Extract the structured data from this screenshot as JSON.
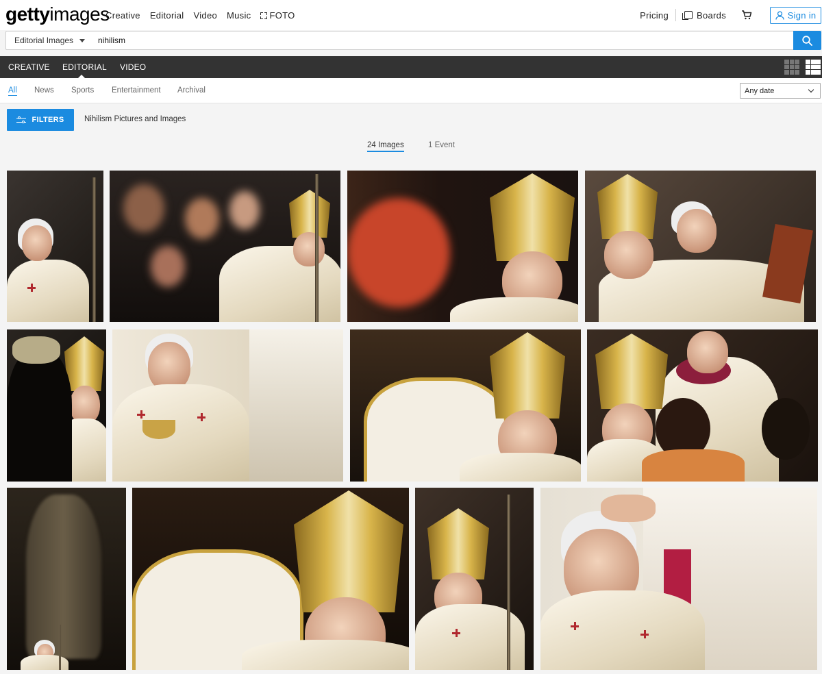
{
  "brand": {
    "logo_bold": "getty",
    "logo_light": "images"
  },
  "topnav": {
    "items": [
      "Creative",
      "Editorial",
      "Video",
      "Music",
      "FOTO"
    ]
  },
  "account": {
    "pricing": "Pricing",
    "boards": "Boards",
    "signin": "Sign in"
  },
  "search": {
    "type_label": "Editorial Images",
    "query": "nihilism"
  },
  "content_types": {
    "tabs": [
      "CREATIVE",
      "EDITORIAL",
      "VIDEO"
    ],
    "active": "EDITORIAL"
  },
  "filters": {
    "tabs": [
      "All",
      "News",
      "Sports",
      "Entertainment",
      "Archival"
    ],
    "active": "All",
    "date_value": "Any date",
    "button_label": "FILTERS"
  },
  "page": {
    "heading": "Nihilism Pictures and Images"
  },
  "results": {
    "images_tab": "24 Images",
    "events_tab": "1 Event"
  },
  "colors": {
    "accent": "#1b8be0",
    "dark_bar": "#333333"
  },
  "icons": [
    "search-icon",
    "cart-icon",
    "user-icon",
    "boards-icon",
    "fullscreen-icon",
    "mosaic-grid-icon",
    "masonry-grid-icon",
    "sliders-icon",
    "chevron-down-icon",
    "caret-down-icon"
  ]
}
